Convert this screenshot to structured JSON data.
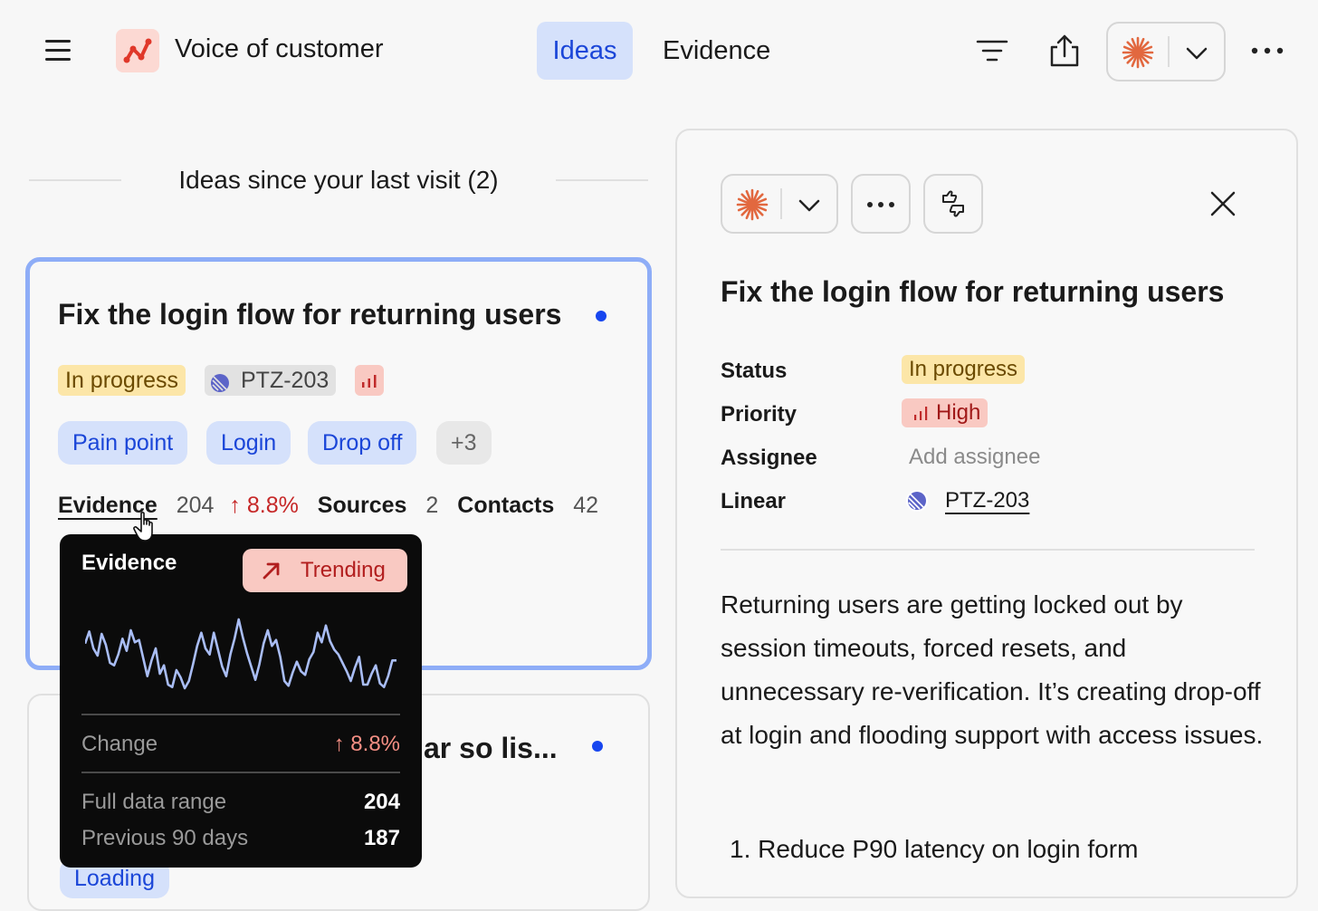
{
  "header": {
    "app_title": "Voice of customer",
    "menu_icon": "hamburger-menu-icon",
    "logo_icon": "chart-line-logo-icon",
    "tabs": [
      {
        "label": "Ideas",
        "active": true
      },
      {
        "label": "Evidence",
        "active": false
      }
    ],
    "actions": [
      "filter-icon",
      "share-icon",
      "sparkle-icon",
      "chevron-down-icon",
      "more-icon"
    ]
  },
  "feed": {
    "section_heading": "Ideas since your last visit (2)",
    "cards": [
      {
        "title": "Fix the login flow for returning users",
        "unread": true,
        "status": "In progress",
        "linear_id": "PTZ-203",
        "tags": [
          "Pain point",
          "Login",
          "Drop off"
        ],
        "more_tags": "+3",
        "stats": {
          "evidence_label": "Evidence",
          "evidence_value": "204",
          "evidence_change": "8.8%",
          "sources_label": "Sources",
          "sources_value": "2",
          "contacts_label": "Contacts",
          "contacts_value": "42"
        }
      },
      {
        "title_visible": "ar so lis...",
        "unread": true,
        "tag_visible": "Loading"
      }
    ]
  },
  "tooltip": {
    "title": "Evidence",
    "badge": "Trending",
    "sparkline": [
      38,
      48,
      34,
      28,
      46,
      37,
      22,
      20,
      29,
      42,
      32,
      49,
      39,
      41,
      26,
      11,
      24,
      34,
      13,
      20,
      4,
      2,
      16,
      10,
      1,
      7,
      21,
      36,
      47,
      34,
      29,
      47,
      33,
      19,
      11,
      29,
      42,
      58,
      43,
      30,
      19,
      8,
      21,
      38,
      49,
      36,
      41,
      27,
      7,
      3,
      14,
      23,
      15,
      12,
      25,
      31,
      47,
      39,
      53,
      40,
      33,
      29,
      22,
      15,
      7,
      18,
      27,
      4,
      4,
      13,
      20,
      5,
      2,
      11,
      24,
      24
    ],
    "change_label": "Change",
    "change_value": "8.8%",
    "full_range_label": "Full data range",
    "full_range_value": "204",
    "prev_label": "Previous 90 days",
    "prev_value": "187"
  },
  "detail": {
    "title": "Fix the login flow for returning users",
    "props": [
      {
        "label": "Status",
        "value": "In progress"
      },
      {
        "label": "Priority",
        "value": "High"
      },
      {
        "label": "Assignee",
        "value": "Add assignee"
      },
      {
        "label": "Linear",
        "value": "PTZ-203"
      }
    ],
    "description": "Returning users are getting locked out by session timeouts, forced resets, and unnecessary re-verification. It’s creating drop-off at login and flooding support with access issues.",
    "list_number": "1.",
    "list_first": "Reduce P90 latency on login form"
  },
  "colors": {
    "accent_blue": "#1b46d8",
    "accent_blue_bg": "#d5e1fb",
    "status_bg": "#fce6a8",
    "priority_bg": "#f9c9c2",
    "priority_text": "#b21e1e",
    "sparkle": "#e2683f"
  }
}
